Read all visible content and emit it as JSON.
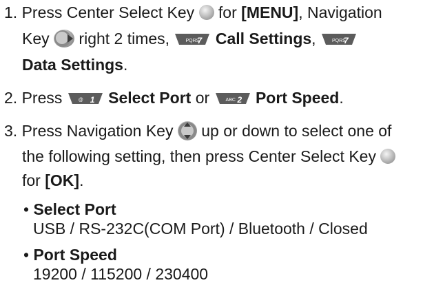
{
  "step1": {
    "number": "1.",
    "press": "Press Center Select Key",
    "menu": "[MENU]",
    "nav_prefix": ", Navigation",
    "key_word": "Key",
    "right_times": "right 2 times,",
    "key7_label": "7",
    "key7_sub": "PQRS",
    "call_settings": "Call Settings",
    "comma": ",",
    "data_settings": "Data Settings",
    "period": "."
  },
  "step2": {
    "number": "2.",
    "press": "Press",
    "key1_label": "1",
    "key1_sub": "@",
    "select_port": "Select Port",
    "or": "or",
    "key2_label": "2",
    "key2_sub": "ABC",
    "port_speed": "Port Speed",
    "period": "."
  },
  "step3": {
    "number": "3.",
    "line1": "Press Navigation Key",
    "line1_end": "up or down to select one of",
    "line2": "the following setting, then press Center Select Key",
    "line3_for": "for",
    "ok": "[OK]",
    "period": "."
  },
  "bullets": [
    {
      "title": "Select Port",
      "values": "USB / RS-232C(COM Port) / Bluetooth / Closed"
    },
    {
      "title": "Port Speed",
      "values": "19200 / 115200 / 230400"
    }
  ],
  "colors": {
    "text": "#1a1a1a",
    "key_fill": "#5c5c5c",
    "key_text": "#ffffff"
  }
}
